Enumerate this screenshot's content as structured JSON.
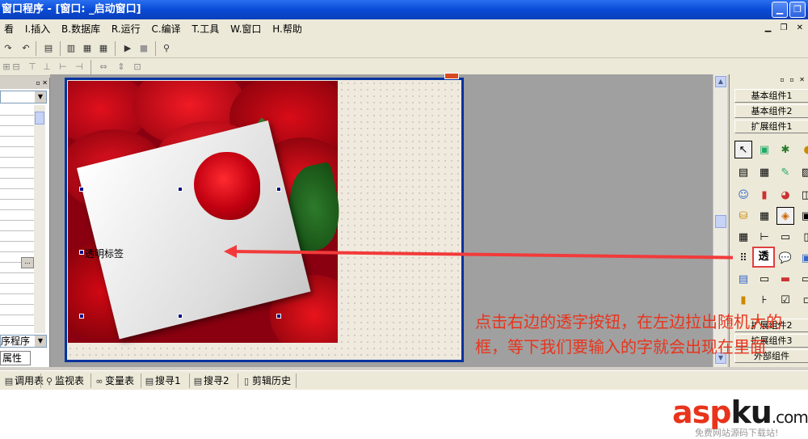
{
  "window": {
    "title": "窗口程序 - [窗口: _启动窗口]",
    "min_glyph": "▁",
    "restore_glyph": "❐",
    "close_glyph": "✕"
  },
  "menu": {
    "items": [
      "看",
      "I.插入",
      "B.数据库",
      "R.运行",
      "C.编译",
      "T.工具",
      "W.窗口",
      "H.帮助"
    ]
  },
  "mdi_controls": "▁ ❐ ✕",
  "left_panel": {
    "header_icons": "▫ ✕",
    "combo_arrow": "▼",
    "ellipsis": "...",
    "bottom_combo_value": "序程序",
    "tab_label": "属性"
  },
  "designer": {
    "label_control_text": "透明标签"
  },
  "right_panel": {
    "header_icons": "▫ ▫ ✕",
    "groups_top": [
      "基本组件1",
      "基本组件2",
      "扩展组件1"
    ],
    "groups_bottom": [
      "扩展组件2",
      "扩展组件3",
      "外部组件"
    ],
    "transparent_label_button": "透"
  },
  "scrollbar": {
    "up": "▲",
    "down": "▼"
  },
  "bottom_tabs": [
    "调用表",
    "监视表",
    "变量表",
    "搜寻1",
    "搜寻2",
    "剪辑历史"
  ],
  "annotation": {
    "text": "点击右边的透字按钮，在左边拉出随机大的框，等下我们要输入的字就会出现在里面"
  },
  "watermark": {
    "brand_a": "asp",
    "brand_b": "ku",
    "brand_c": ".com",
    "sub": "免费网站源码下载站!"
  },
  "colors": {
    "title_blue": "#0a4bd6",
    "annotation_red": "#e8341c",
    "selection_border": "#0033a0"
  }
}
